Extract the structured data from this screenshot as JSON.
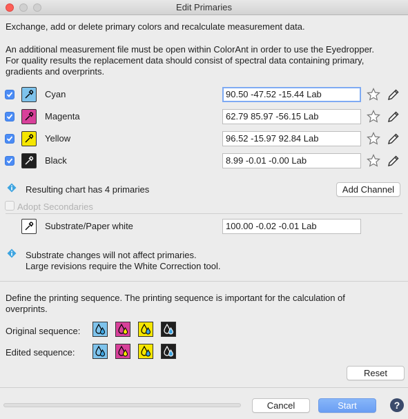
{
  "window": {
    "title": "Edit Primaries"
  },
  "intro": {
    "line1": "Exchange, add or delete primary colors and recalculate measurement data.",
    "line2": "An additional measurement file must be open within ColorAnt in order to use the Eyedropper.",
    "line3": "For quality results the replacement data should consist of spectral data containing primary,",
    "line4": "gradients and overprints."
  },
  "channels": [
    {
      "name": "Cyan",
      "value": "90.50 -47.52 -15.44 Lab",
      "color": "#7ec3ec",
      "checked": true
    },
    {
      "name": "Magenta",
      "value": "62.79 85.97 -56.15 Lab",
      "color": "#d8409a",
      "checked": true
    },
    {
      "name": "Yellow",
      "value": "96.52 -15.97 92.84 Lab",
      "color": "#f5e600",
      "checked": true
    },
    {
      "name": "Black",
      "value": "8.99 -0.01 -0.00 Lab",
      "color": "#1f1f1f",
      "checked": true
    }
  ],
  "result": {
    "text": "Resulting chart has 4 primaries",
    "add_channel": "Add Channel"
  },
  "adopt": {
    "label": "Adopt Secondaries"
  },
  "substrate": {
    "name": "Substrate/Paper white",
    "value": "100.00 -0.02 -0.01 Lab"
  },
  "substrate_note": {
    "line1": "Substrate changes will not affect primaries.",
    "line2": "Large revisions require the White Correction tool."
  },
  "sequence": {
    "desc1": "Define the printing sequence. The printing sequence is important for the calculation of",
    "desc2": "overprints.",
    "original_label": "Original sequence:",
    "edited_label": "Edited sequence:",
    "colors": [
      "#7ec3ec",
      "#d8409a",
      "#f5e600",
      "#1f1f1f"
    ]
  },
  "buttons": {
    "reset": "Reset",
    "cancel": "Cancel",
    "start": "Start",
    "help": "?"
  },
  "colors": {
    "accent": "#4c8cf5",
    "info": "#3da4e0"
  }
}
